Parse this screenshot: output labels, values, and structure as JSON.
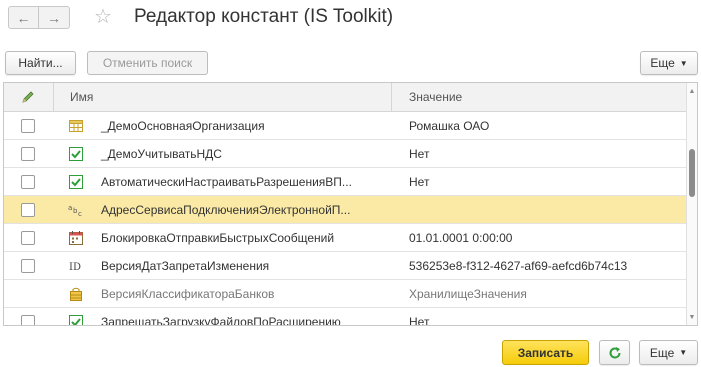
{
  "window": {
    "title": "Редактор констант (IS Toolkit)"
  },
  "toolbar": {
    "find_label": "Найти...",
    "cancel_search_label": "Отменить поиск",
    "more_label": "Еще"
  },
  "table": {
    "columns": {
      "name": "Имя",
      "value": "Значение"
    },
    "rows": [
      {
        "icon": "table-icon",
        "name": "_ДемоОсновнаяОрганизация",
        "value": "Ромашка ОАО",
        "selected": false,
        "dimmed": false
      },
      {
        "icon": "checkbox-checked-icon",
        "name": "_ДемоУчитыватьНДС",
        "value": "Нет",
        "selected": false,
        "dimmed": false
      },
      {
        "icon": "checkbox-checked-icon",
        "name": "АвтоматическиНастраиватьРазрешенияВП...",
        "value": "Нет",
        "selected": false,
        "dimmed": false
      },
      {
        "icon": "string-type-icon",
        "name": "АдресСервисаПодключенияЭлектроннойП...",
        "value": "",
        "selected": true,
        "dimmed": false
      },
      {
        "icon": "calendar-icon",
        "name": "БлокировкаОтправкиБыстрыхСообщений",
        "value": "01.01.0001 0:00:00",
        "selected": false,
        "dimmed": false
      },
      {
        "icon": "id-icon",
        "name": "ВерсияДатЗапретаИзменения",
        "value": "536253e8-f312-4627-af69-aefcd6b74c13",
        "selected": false,
        "dimmed": false
      },
      {
        "icon": "storage-icon",
        "name": "ВерсияКлассификатораБанков",
        "value": "ХранилищеЗначения",
        "selected": false,
        "dimmed": true
      },
      {
        "icon": "checkbox-checked-icon",
        "name": "ЗапрещатьЗагрузкуФайловПоРасширению",
        "value": "Нет",
        "selected": false,
        "dimmed": false
      }
    ]
  },
  "footer": {
    "save_label": "Записать",
    "more_label": "Еще"
  },
  "colors": {
    "accent_yellow": "#f5cc0a",
    "selected_row": "#fbeaa6",
    "check_green": "#2e9e3a"
  }
}
